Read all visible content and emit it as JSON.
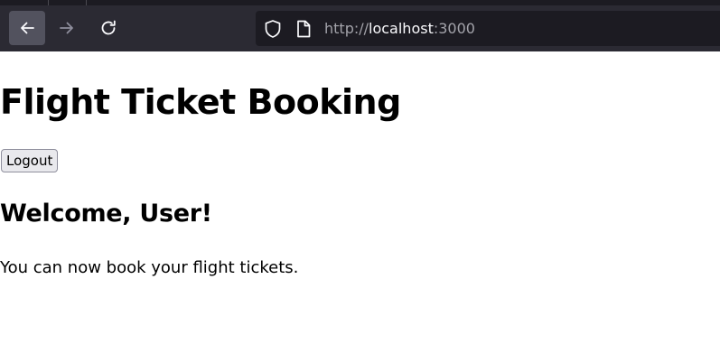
{
  "browser": {
    "url_scheme": "http://",
    "url_host": "localhost",
    "url_port": ":3000",
    "icons": {
      "back": "arrow-left-icon",
      "forward": "arrow-right-icon",
      "reload": "reload-icon",
      "security": "shield-icon",
      "page": "page-icon"
    }
  },
  "page": {
    "title": "Flight Ticket Booking",
    "logout_label": "Logout",
    "welcome": "Welcome, User!",
    "message": "You can now book your flight tickets."
  },
  "colors": {
    "toolbar_bg": "#2b2a33",
    "url_bar_bg": "#1c1b22",
    "page_bg": "#ffffff",
    "text": "#000000",
    "button_bg": "#e9e9ed"
  }
}
